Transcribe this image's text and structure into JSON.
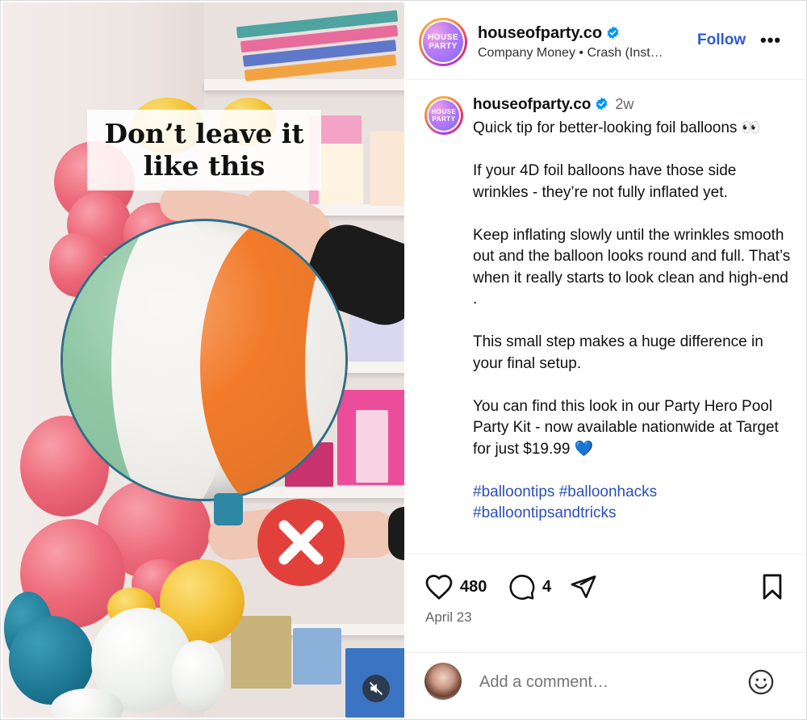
{
  "post": {
    "account_name": "houseofparty.co",
    "avatar_text": "HOUSE PARTY",
    "subtitle": "Company Money • Crash (Inst…",
    "follow_label": "Follow",
    "more_label": "•••",
    "caption": {
      "time": "2w",
      "lines": [
        "Quick tip for better-looking foil balloons 👀",
        "If your 4D foil balloons have those side wrinkles - they’re not fully inflated yet.",
        "Keep inflating slowly until the wrinkles smooth out and the balloon looks round and full. That’s when it really starts to look clean and high-end .",
        "This small step makes a huge difference in your final setup.",
        "You can find this look in our Party Hero Pool Party Kit - now available nationwide at Target for just $19.99 💙"
      ],
      "hashtags": "#balloontips #balloonhacks #balloontipsandtricks"
    },
    "likes": "480",
    "comments": "4",
    "date": "April 23",
    "comment_placeholder": "Add a comment…"
  },
  "media": {
    "overlay_text": "Don’t leave it like this"
  },
  "colors": {
    "accent_blue": "#2f59d8",
    "verified_blue": "#0095f6",
    "x_red": "#e2413b",
    "orange_stripe": "#f27b2b",
    "green_stripe": "#8fc7a4"
  },
  "icons": [
    "verified-badge-icon",
    "heart-icon",
    "comment-icon",
    "share-icon",
    "bookmark-icon",
    "emoji-icon",
    "mute-icon",
    "x-mark-icon"
  ]
}
